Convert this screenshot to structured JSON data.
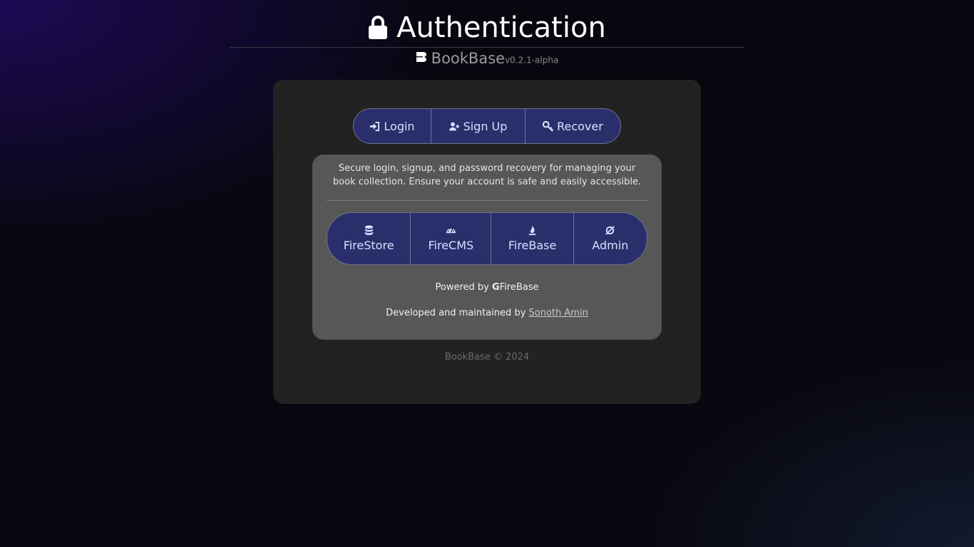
{
  "header": {
    "title": "Authentication",
    "brand": "BookBase",
    "version": "v0.2.1-alpha"
  },
  "tabs": [
    {
      "label": "Login",
      "icon": "sign-in-icon"
    },
    {
      "label": "Sign Up",
      "icon": "user-plus-icon"
    },
    {
      "label": "Recover",
      "icon": "key-icon"
    }
  ],
  "panel": {
    "description": "Secure login, signup, and password recovery for managing your book collection. Ensure your account is safe and easily accessible.",
    "links": [
      {
        "label": "FireStore",
        "icon": "database-icon"
      },
      {
        "label": "FireCMS",
        "icon": "gauge-icon"
      },
      {
        "label": "FireBase",
        "icon": "fire-icon"
      },
      {
        "label": "Admin",
        "icon": "galactic-icon"
      }
    ],
    "powered_by_prefix": "Powered by",
    "powered_by_name": "FireBase",
    "developed_prefix": "Developed and maintained by",
    "developer_name": "Sonoth Amin"
  },
  "footer": {
    "text": "BookBase © 2024"
  },
  "colors": {
    "accent_button": "#2a2f6b",
    "button_text": "#d6e0ff",
    "card": "#222222",
    "panel": "#575757"
  }
}
